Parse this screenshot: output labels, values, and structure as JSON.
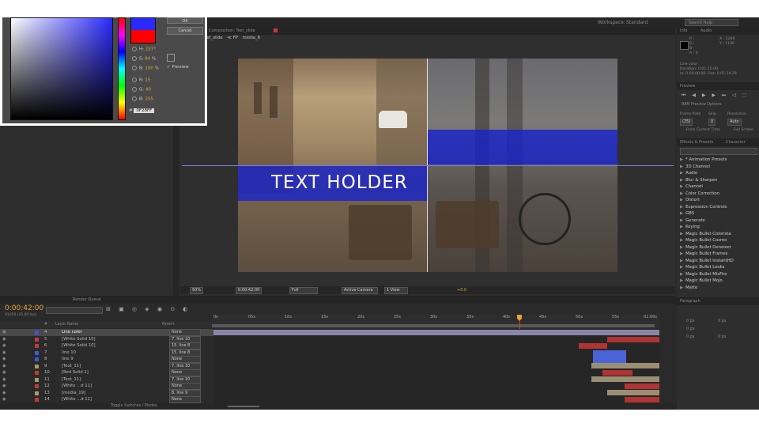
{
  "colors": {
    "accent": "#e8a43a",
    "band": "#1e2ad0",
    "cti": "#e04040"
  },
  "topbar": {
    "workspace_label": "Workspace:",
    "workspace_value": "Standard",
    "search_placeholder": "Search Help"
  },
  "color_picker": {
    "ok_label": "OK",
    "cancel_label": "Cancel",
    "preview_label": "Preview",
    "fields": [
      {
        "key": "H:",
        "value": "237",
        "unit": "°"
      },
      {
        "key": "S:",
        "value": "84",
        "unit": "%"
      },
      {
        "key": "B:",
        "value": "100",
        "unit": "%"
      },
      {
        "key": "R:",
        "value": "15",
        "unit": ""
      },
      {
        "key": "G:",
        "value": "40",
        "unit": ""
      },
      {
        "key": "B:",
        "value": "255",
        "unit": ""
      }
    ],
    "hex_label": "#",
    "hex_value": "0F28FF"
  },
  "viewer": {
    "tab_label": "Composition: Text_slide",
    "comp_name": "Text_slide",
    "nav": [
      "≪ FP",
      "media_6"
    ],
    "text_holder": "TEXT HOLDER",
    "zoom": "50%",
    "timecode": "0:00:42:00",
    "resolution": "Full",
    "camera": "Active Camera",
    "views": "1 View",
    "exposure": "+0.0"
  },
  "info_panel": {
    "tab": "Info",
    "tab2": "Audio",
    "rgb": [
      "R :",
      "G :",
      "B :",
      "A : 0"
    ],
    "xy": [
      "X : 1268",
      "Y : 1146"
    ],
    "layer_name": "Line color",
    "duration": "Duration: 0:01:15:00",
    "in_out": "In: 0:00:00:00, Out: 0:01:14:29"
  },
  "preview_panel": {
    "tab": "Preview",
    "ram_label": "RAM Preview Options",
    "frame_rate_label": "Frame Rate",
    "skip_label": "Skip",
    "resolution_label": "Resolution",
    "frame_rate": "(25)",
    "skip": "0",
    "resolution": "Auto",
    "from_current": "From Current Time",
    "full_screen": "Full Screen"
  },
  "effects_panel": {
    "tab": "Effects & Presets",
    "tab2": "Character",
    "items": [
      "* Animation Presets",
      "3D Channel",
      "Audio",
      "Blur & Sharpen",
      "Channel",
      "Color Correction",
      "Distort",
      "Expression Controls",
      "GBS",
      "Generate",
      "Keying",
      "Magic Bullet Colorista",
      "Magic Bullet Cosmo",
      "Magic Bullet Denoiser",
      "Magic Bullet Frames",
      "Magic Bullet InstantHD",
      "Magic Bullet Looks",
      "Magic Bullet MisFire",
      "Magic Bullet Mojo",
      "Matte"
    ]
  },
  "paragraph_panel": {
    "tab": "Paragraph",
    "values": [
      "0 px",
      "0 px",
      "0 px",
      "0 px",
      "0 px"
    ]
  },
  "timeline": {
    "timecode": "0:00:42:00",
    "fps": "01050 (25.00 fps)",
    "tabs": [
      "Render Queue",
      "",
      ""
    ],
    "columns": {
      "num": "#",
      "name": "Layer Name",
      "parent": "Parent"
    },
    "ruler": [
      "0s",
      "05s",
      "10s",
      "15s",
      "20s",
      "25s",
      "30s",
      "35s",
      "40s",
      "45s",
      "50s",
      "55s",
      "01:00s"
    ],
    "toggle_label": "Toggle Switches / Modes",
    "layers": [
      {
        "num": "4",
        "name": "Line color",
        "parent": "None",
        "color": "#3b5bd6",
        "selected": true
      },
      {
        "num": "5",
        "name": "[White Solid 10]",
        "parent": "7. line 10",
        "color": "#c23b3b"
      },
      {
        "num": "6",
        "name": "[White Solid 10]",
        "parent": "15. line 8",
        "color": "#c23b3b"
      },
      {
        "num": "7",
        "name": "line 10",
        "parent": "15. line 8",
        "color": "#3b5bd6"
      },
      {
        "num": "8",
        "name": "line 9",
        "parent": "None",
        "color": "#3b5bd6"
      },
      {
        "num": "9",
        "name": "[Text_11]",
        "parent": "7. line 10",
        "color": "#a4a05a"
      },
      {
        "num": "10",
        "name": "[Red Solid 1]",
        "parent": "None",
        "color": "#c23b3b"
      },
      {
        "num": "11",
        "name": "[Text_11]",
        "parent": "7. line 10",
        "color": "#a4a05a"
      },
      {
        "num": "12",
        "name": "[White ...d 11]",
        "parent": "None",
        "color": "#c23b3b"
      },
      {
        "num": "13",
        "name": "[media_19]",
        "parent": "8. line 9",
        "color": "#a4a05a"
      },
      {
        "num": "14",
        "name": "[White ...d 11]",
        "parent": "None",
        "color": "#c23b3b"
      }
    ]
  }
}
